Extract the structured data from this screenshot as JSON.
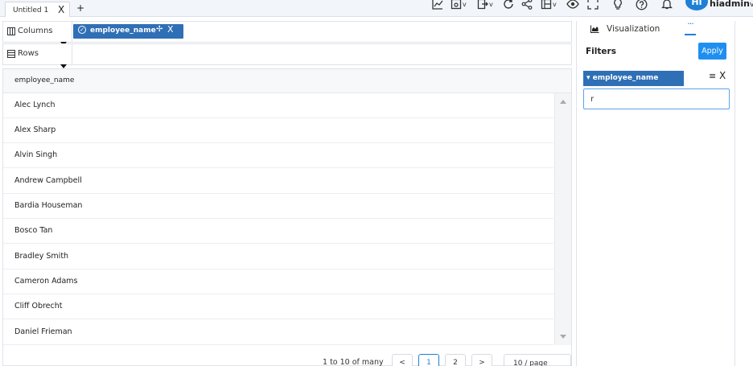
{
  "tabs": [
    {
      "label": "Untitled 1",
      "close": "X"
    }
  ],
  "add_tab": "+",
  "toolbar": {
    "icons": [
      "chart-line-icon",
      "dashboard-icon",
      "export-icon",
      "refresh-icon",
      "share-icon",
      "layout-icon",
      "view-icon",
      "fullscreen-icon",
      "lightbulb-icon",
      "help-icon",
      "bell-icon"
    ],
    "caret": "v"
  },
  "user": {
    "initials": "HI",
    "name": "hiadmin",
    "caret": "v"
  },
  "shelves": {
    "columns": {
      "label": "Columns",
      "pill": {
        "check": "✓",
        "label": "employee_name",
        "move": "✢",
        "close": "X"
      }
    },
    "rows": {
      "label": "Rows"
    }
  },
  "table": {
    "header": "employee_name",
    "rows": [
      "Alec Lynch",
      "Alex Sharp",
      "Alvin Singh",
      "Andrew Campbell",
      "Bardia Houseman",
      "Bosco Tan",
      "Bradley Smith",
      "Cameron Adams",
      "Cliff Obrecht",
      "Daniel Frieman"
    ]
  },
  "pagination": {
    "info": "1 to 10 of many",
    "prev": "<",
    "pages": [
      "1",
      "2"
    ],
    "current": "1",
    "next": ">",
    "page_size": "10 / page"
  },
  "panel": {
    "tab_label": "Visualization",
    "more": "···",
    "filters_title": "Filters",
    "apply_label": "Apply",
    "filter": {
      "field": "▾ employee_name",
      "menu": "≡",
      "close": "X",
      "value": "r"
    }
  },
  "colors": {
    "accent": "#1e7fd6",
    "pill": "#2f6fb5",
    "apply": "#1e8ff0"
  }
}
